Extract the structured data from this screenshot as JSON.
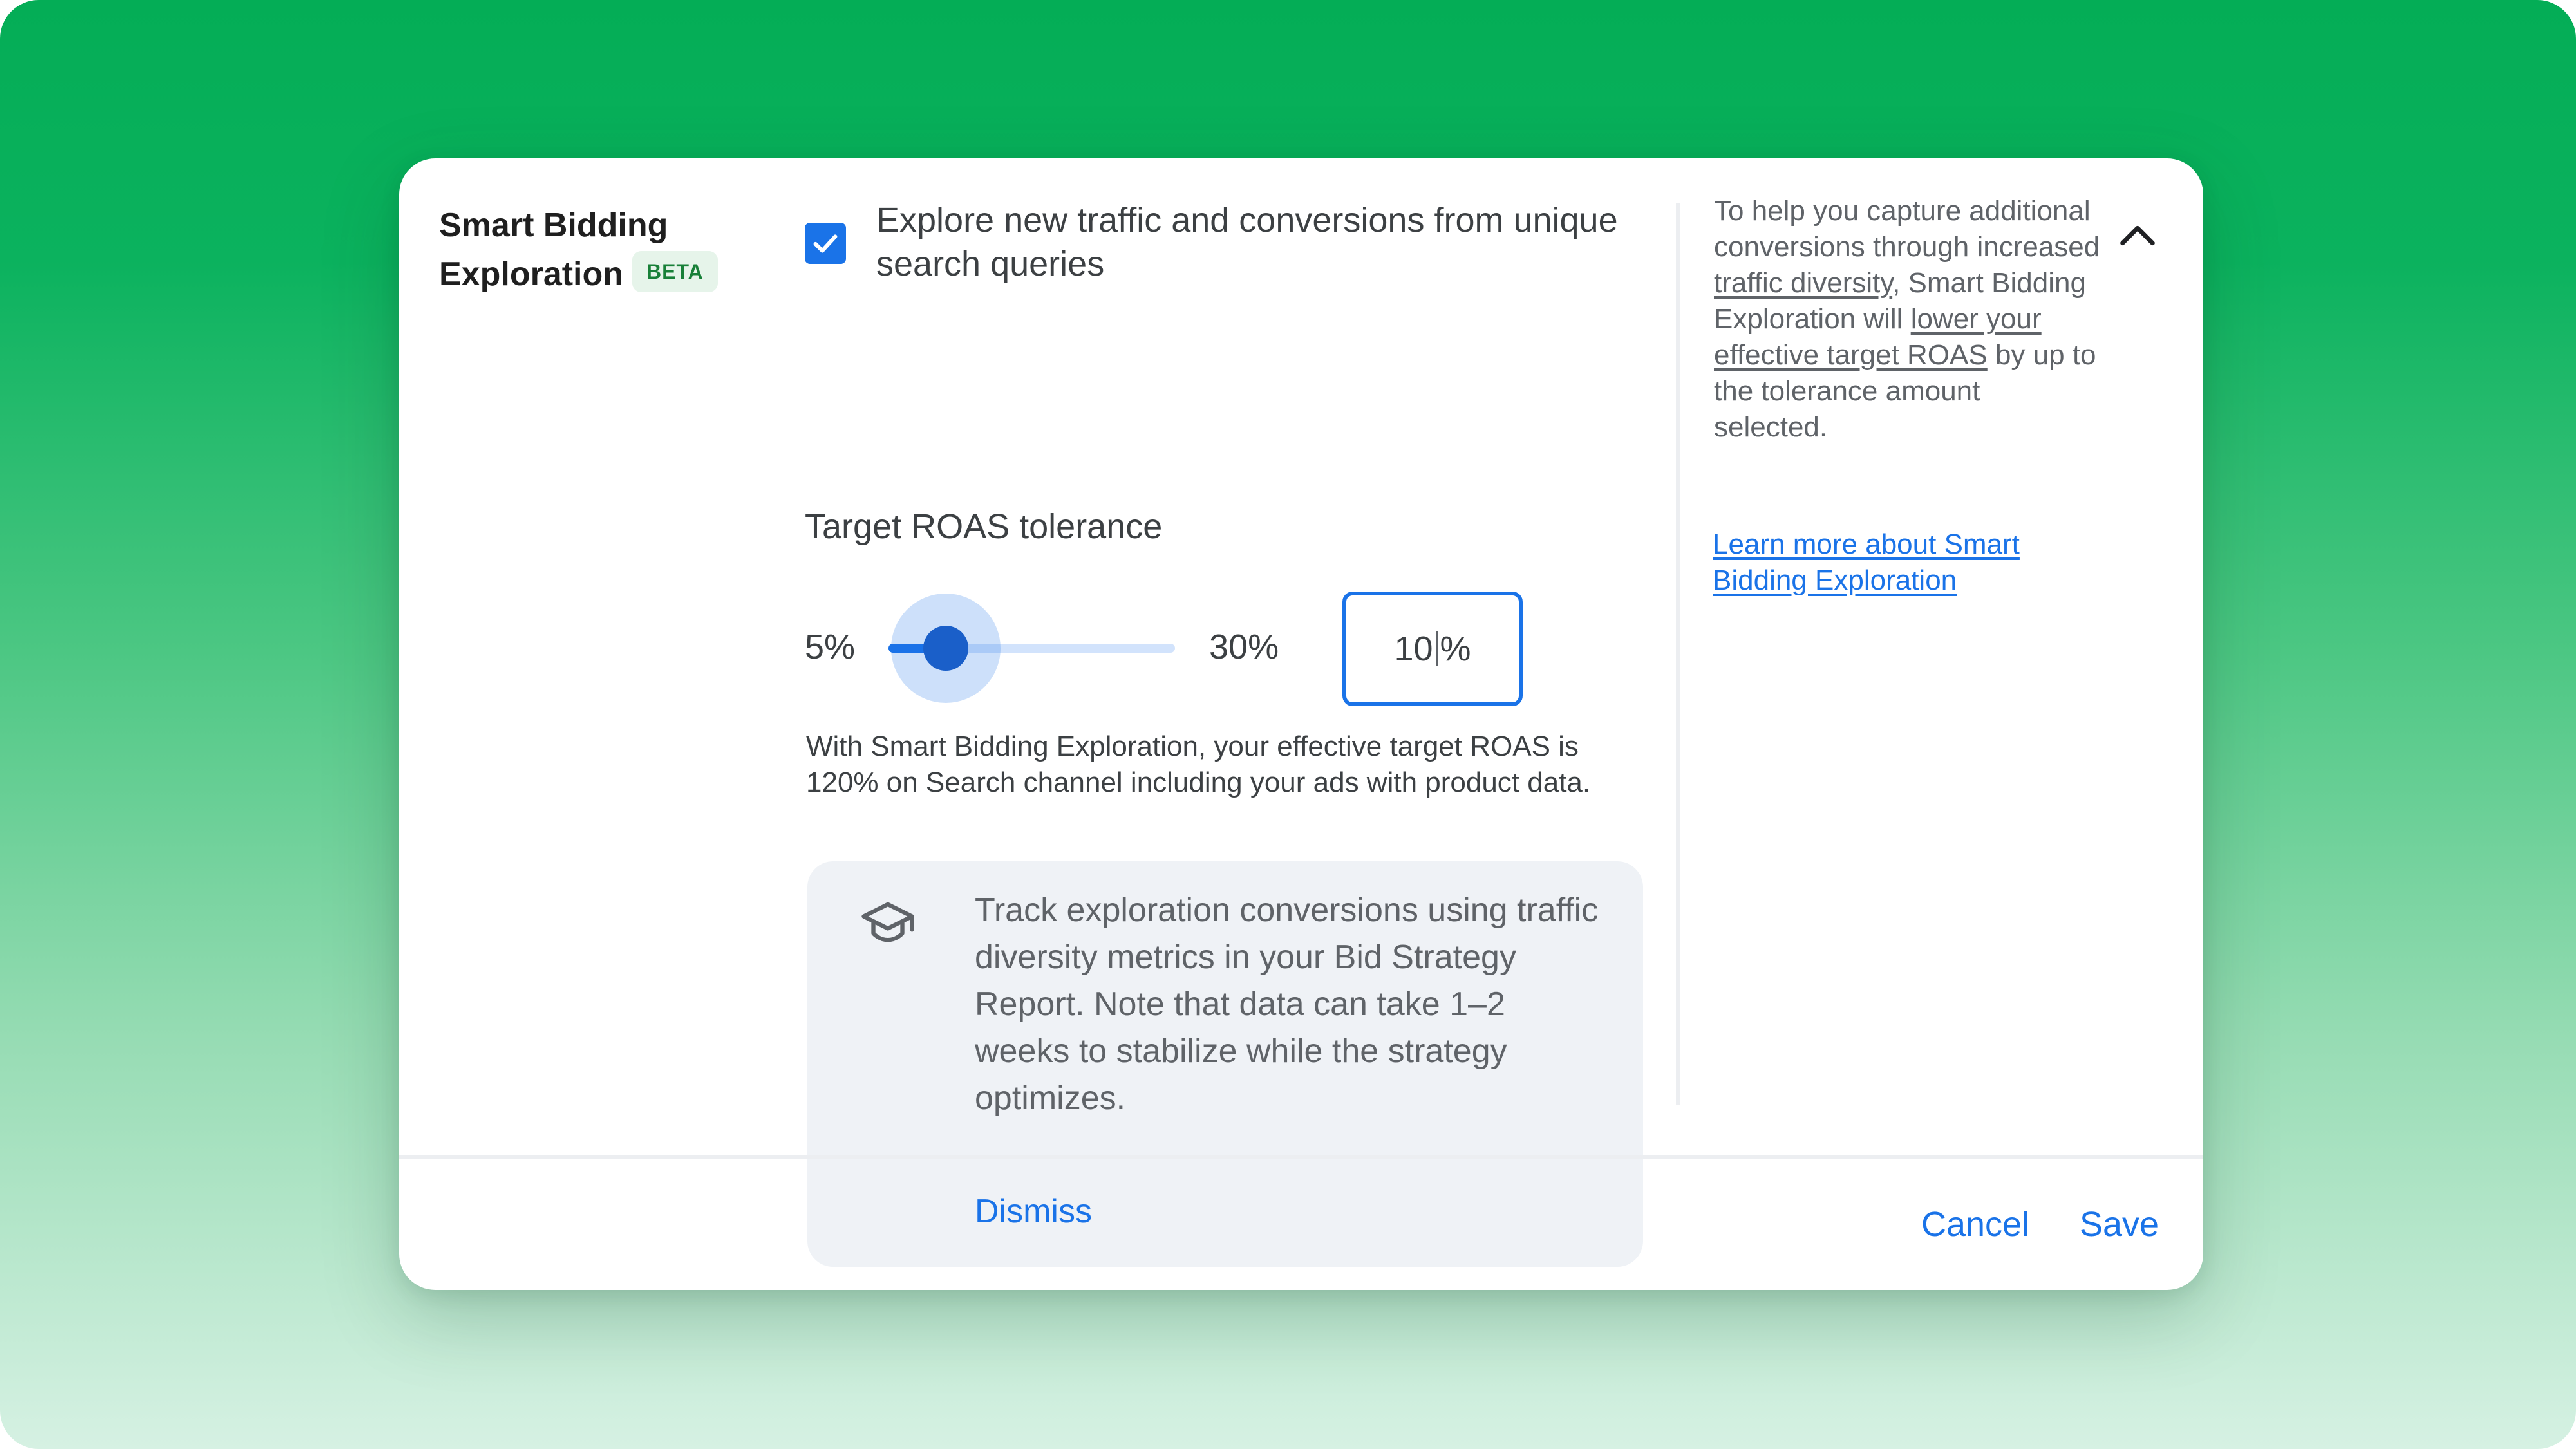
{
  "section": {
    "title_line1": "Smart Bidding",
    "title_line2": "Exploration",
    "badge": "BETA"
  },
  "explore_option": {
    "checked": true,
    "label": "Explore new traffic and conversions from unique search queries"
  },
  "tolerance": {
    "label": "Target ROAS tolerance",
    "min_label": "5%",
    "max_label": "30%",
    "min": 5,
    "max": 30,
    "value": 10,
    "input_number": "10",
    "input_unit": "%"
  },
  "helper_text": "With Smart Bidding Exploration, your effective target ROAS is 120% on Search channel including your ads with product data.",
  "info_card": {
    "icon": "graduation-cap-icon",
    "text": "Track exploration conversions using traffic diversity metrics in your Bid Strategy Report. Note that data can take 1–2 weeks to stabilize while the strategy optimizes.",
    "dismiss_label": "Dismiss"
  },
  "side_panel": {
    "help_part1": "To help you capture additional conversions through increased ",
    "help_link1": "traffic diversity",
    "help_part2": ", Smart Bidding Exploration will ",
    "help_link2": "lower your effective target ROAS",
    "help_part3": " by up to the tolerance amount selected.",
    "learn_more": "Learn more about Smart Bidding Exploration",
    "collapse_icon": "chevron-up-icon"
  },
  "footer": {
    "cancel_label": "Cancel",
    "save_label": "Save"
  },
  "colors": {
    "accent": "#1a73e8",
    "badge_bg": "#e6f4ea",
    "badge_text": "#188038",
    "background_top": "#04ad56"
  }
}
